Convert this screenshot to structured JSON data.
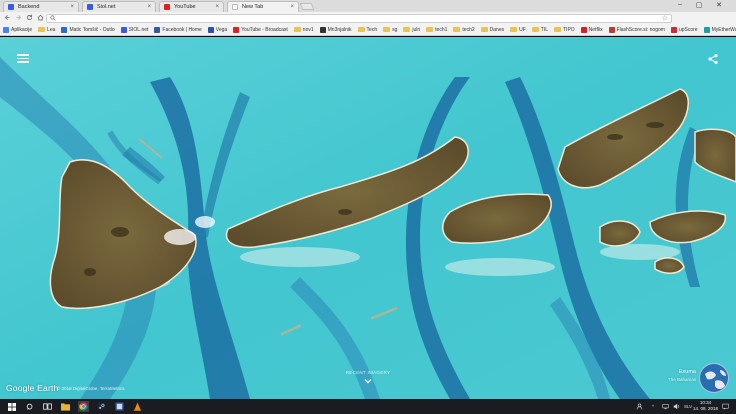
{
  "browser": {
    "tabs": [
      {
        "label": "Backend",
        "active": false,
        "favicon_color": "#3b5bdb"
      },
      {
        "label": "Siol.net",
        "active": false,
        "favicon_color": "#3b5bdb"
      },
      {
        "label": "YouTube",
        "active": false,
        "favicon_color": "#e02020"
      },
      {
        "label": "New Tab",
        "active": true,
        "favicon_color": "#ffffff"
      }
    ],
    "address": {
      "value": "",
      "placeholder": ""
    },
    "window_controls": {
      "minimize": "–",
      "maximize": "▢",
      "close": "✕"
    }
  },
  "bookmarks": [
    {
      "label": "Aplikacije",
      "kind": "apps",
      "color": "#4285f4"
    },
    {
      "label": "Lea",
      "kind": "folder"
    },
    {
      "label": "Matic Tomšič - Outlo",
      "kind": "site",
      "color": "#2b6cc4"
    },
    {
      "label": "SIOL.net",
      "kind": "site",
      "color": "#3b5bdb"
    },
    {
      "label": "Facebook | Home",
      "kind": "site",
      "color": "#3b5998"
    },
    {
      "label": "Vega",
      "kind": "site",
      "color": "#2f4fa8"
    },
    {
      "label": "YouTube - Broadcast",
      "kind": "site",
      "color": "#e02020"
    },
    {
      "label": "nov1",
      "kind": "folder"
    },
    {
      "label": "Mn3njalnik",
      "kind": "site",
      "color": "#333333"
    },
    {
      "label": "Tech",
      "kind": "folder"
    },
    {
      "label": "sg",
      "kind": "folder"
    },
    {
      "label": "julri",
      "kind": "folder"
    },
    {
      "label": "tech1",
      "kind": "folder"
    },
    {
      "label": "tech2",
      "kind": "folder"
    },
    {
      "label": "Danes",
      "kind": "folder"
    },
    {
      "label": "UF",
      "kind": "folder"
    },
    {
      "label": "TIL",
      "kind": "folder"
    },
    {
      "label": "TIPO",
      "kind": "folder"
    },
    {
      "label": "Netflix",
      "kind": "site",
      "color": "#d81f26"
    },
    {
      "label": "FlashScore.si: nogom",
      "kind": "site",
      "color": "#c0392b"
    },
    {
      "label": "upScore",
      "kind": "site",
      "color": "#cc2a36"
    },
    {
      "label": "MyEtherWallet.com",
      "kind": "site",
      "color": "#1aa3a3"
    }
  ],
  "earth": {
    "logo": "Google Earth",
    "copyright": "© 2018 DigitalGlobe, TerraMetrics",
    "recent_label": "RECENT IMAGERY",
    "place_name": "Exuma",
    "place_country": "The Bahamas",
    "colors": {
      "water": "#3fc5cf",
      "channel": "#1f74a6",
      "land": "#6d5b34",
      "sand": "#e6f4f0"
    }
  },
  "taskbar": {
    "time": "10:34",
    "date": "14. 08. 2018",
    "language": "SLV"
  }
}
